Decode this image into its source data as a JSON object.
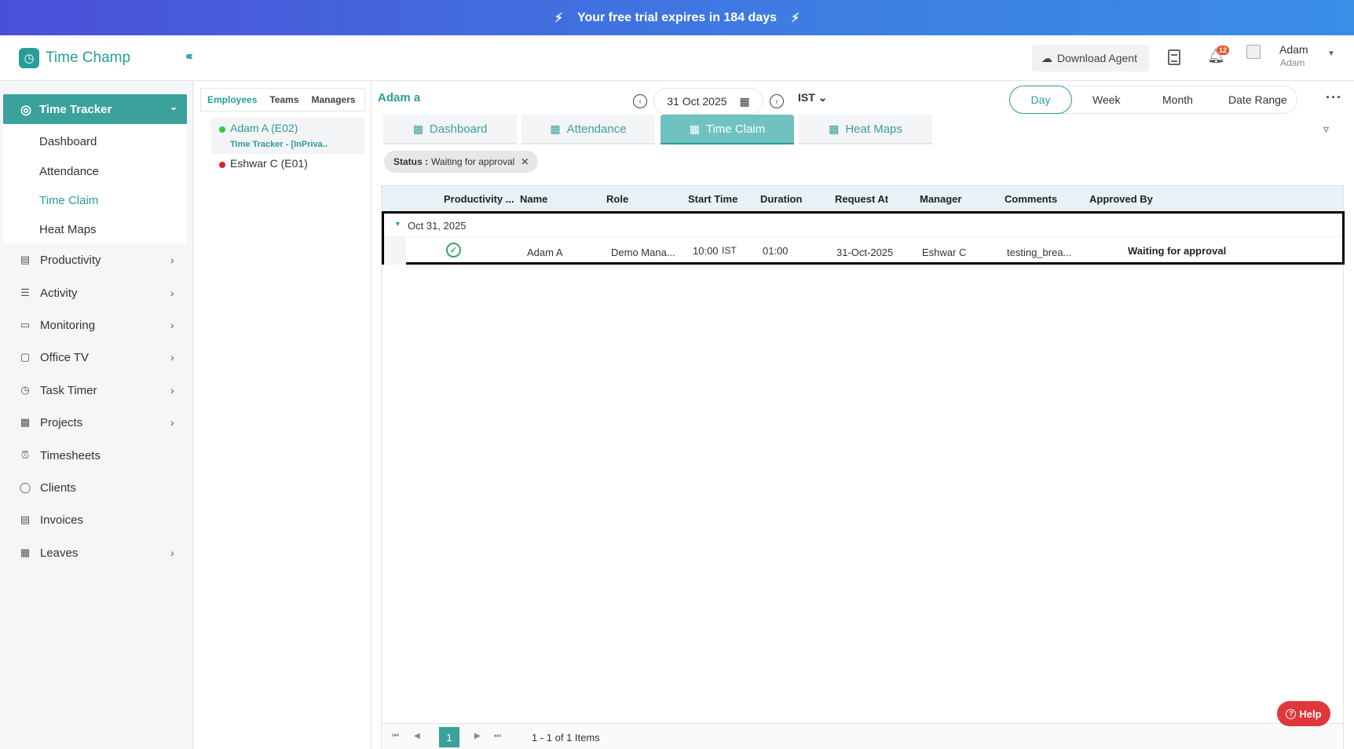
{
  "banner": {
    "text": "Your free trial expires in 184 days"
  },
  "header": {
    "app_name": "Time Champ",
    "download_label": "Download Agent",
    "notification_count": "12",
    "user_name": "Adam",
    "user_sub": "Adam"
  },
  "sidebar": {
    "active": {
      "label": "Time Tracker"
    },
    "submenu": [
      {
        "label": "Dashboard"
      },
      {
        "label": "Attendance"
      },
      {
        "label": "Time Claim"
      },
      {
        "label": "Heat Maps"
      }
    ],
    "items": [
      {
        "label": "Productivity"
      },
      {
        "label": "Activity"
      },
      {
        "label": "Monitoring"
      },
      {
        "label": "Office TV"
      },
      {
        "label": "Task Timer"
      },
      {
        "label": "Projects"
      },
      {
        "label": "Timesheets"
      },
      {
        "label": "Clients"
      },
      {
        "label": "Invoices"
      },
      {
        "label": "Leaves"
      }
    ]
  },
  "employees": {
    "tabs": [
      "Employees",
      "Teams",
      "Managers"
    ],
    "list": [
      {
        "name": "Adam A (E02)",
        "sub": "Time Tracker - [InPriva..",
        "status_color": "#2ecc40"
      },
      {
        "name": "Eshwar C (E01)",
        "status_color": "#e02424"
      }
    ]
  },
  "main": {
    "employee_title": "Adam a",
    "date": "31 Oct 2025",
    "timezone": "IST",
    "ranges": [
      "Day",
      "Week",
      "Month",
      "Date Range"
    ],
    "tabs": [
      {
        "label": "Dashboard",
        "icon": "dashboard-icon"
      },
      {
        "label": "Attendance",
        "icon": "calendar-icon"
      },
      {
        "label": "Time Claim",
        "icon": "calendar-check-icon"
      },
      {
        "label": "Heat Maps",
        "icon": "heatmap-icon"
      }
    ],
    "filter_chip": {
      "key": "Status :",
      "value": "Waiting for approval"
    }
  },
  "grid": {
    "columns": [
      "Productivity ...",
      "Name",
      "Role",
      "Start Time",
      "Duration",
      "Request At",
      "Manager",
      "Comments",
      "Approved By"
    ],
    "group_label": "Oct 31, 2025",
    "row": {
      "name": "Adam A",
      "role": "Demo Mana...",
      "start_time": "10:00",
      "start_tz": "IST",
      "duration": "01:00",
      "request_at": "31-Oct-2025",
      "manager": "Eshwar C",
      "comments": "testing_brea...",
      "status": "Waiting for approval"
    },
    "pager": {
      "page": "1",
      "info": "1 - 1 of 1 Items"
    }
  },
  "help": {
    "label": "Help"
  },
  "colors": {
    "accent": "#2a9d99",
    "active_bg": "#3aa19b",
    "help": "#e0373b"
  }
}
